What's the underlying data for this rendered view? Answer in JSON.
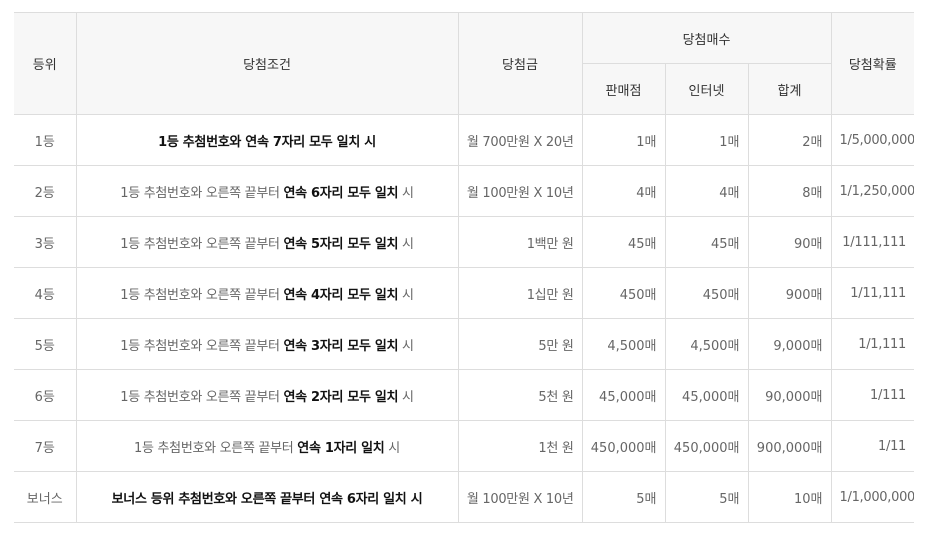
{
  "headers": {
    "rank": "등위",
    "condition": "당첨조건",
    "prize": "당첨금",
    "winners": "당첨매수",
    "store": "판매점",
    "internet": "인터넷",
    "total": "합계",
    "probability": "당첨확률"
  },
  "rows": [
    {
      "rank": "1등",
      "cond_pre": "",
      "cond_bold": "1등 추첨번호와 연속 7자리 모두 일치 시",
      "cond_post": "",
      "prize": "월 700만원 X 20년",
      "store": "1매",
      "internet": "1매",
      "total": "2매",
      "probability": "1/5,000,000"
    },
    {
      "rank": "2등",
      "cond_pre": "1등 추첨번호와 오른쪽 끝부터 ",
      "cond_bold": "연속 6자리 모두 일치",
      "cond_post": " 시",
      "prize": "월 100만원 X 10년",
      "store": "4매",
      "internet": "4매",
      "total": "8매",
      "probability": "1/1,250,000"
    },
    {
      "rank": "3등",
      "cond_pre": "1등 추첨번호와 오른쪽 끝부터 ",
      "cond_bold": "연속 5자리 모두 일치",
      "cond_post": " 시",
      "prize": "1백만 원",
      "store": "45매",
      "internet": "45매",
      "total": "90매",
      "probability": "1/111,111"
    },
    {
      "rank": "4등",
      "cond_pre": "1등 추첨번호와 오른쪽 끝부터 ",
      "cond_bold": "연속 4자리 모두 일치",
      "cond_post": " 시",
      "prize": "1십만 원",
      "store": "450매",
      "internet": "450매",
      "total": "900매",
      "probability": "1/11,111"
    },
    {
      "rank": "5등",
      "cond_pre": "1등 추첨번호와 오른쪽 끝부터 ",
      "cond_bold": "연속 3자리 모두 일치",
      "cond_post": " 시",
      "prize": "5만 원",
      "store": "4,500매",
      "internet": "4,500매",
      "total": "9,000매",
      "probability": "1/1,111"
    },
    {
      "rank": "6등",
      "cond_pre": "1등 추첨번호와 오른쪽 끝부터 ",
      "cond_bold": "연속 2자리 모두 일치",
      "cond_post": " 시",
      "prize": "5천 원",
      "store": "45,000매",
      "internet": "45,000매",
      "total": "90,000매",
      "probability": "1/111"
    },
    {
      "rank": "7등",
      "cond_pre": "1등 추첨번호와 오른쪽 끝부터 ",
      "cond_bold": "연속 1자리 일치",
      "cond_post": " 시",
      "prize": "1천 원",
      "store": "450,000매",
      "internet": "450,000매",
      "total": "900,000매",
      "probability": "1/11"
    },
    {
      "rank": "보너스",
      "cond_pre": "",
      "cond_bold": "보너스 등위 추첨번호와 오른쪽 끝부터 연속 6자리 일치 시",
      "cond_post": "",
      "prize": "월 100만원 X 10년",
      "store": "5매",
      "internet": "5매",
      "total": "10매",
      "probability": "1/1,000,000"
    }
  ]
}
